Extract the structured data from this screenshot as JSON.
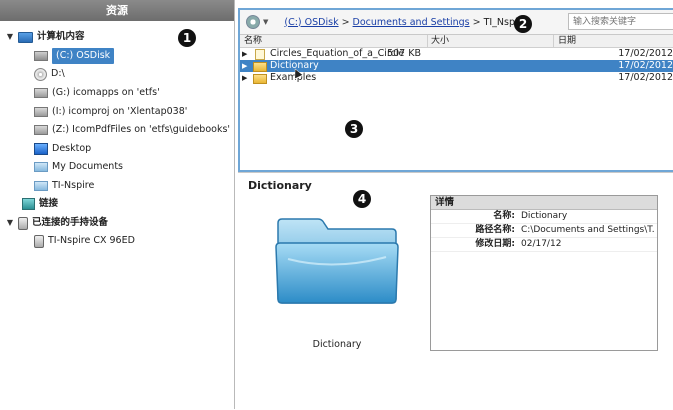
{
  "left_panel": {
    "header": "资源",
    "tree": [
      {
        "label": "计算机内容",
        "icon": "computer-icon",
        "expander": "▼",
        "bold": true
      },
      {
        "label": "(C:) OSDisk",
        "icon": "disk-drive-icon",
        "selected": true
      },
      {
        "label": "D:\\",
        "icon": "dvd-drive-icon"
      },
      {
        "label": "(G:) icomapps on 'etfs'",
        "icon": "network-drive-icon"
      },
      {
        "label": "(I:) icomproj on 'Xlentap038'",
        "icon": "network-drive-icon"
      },
      {
        "label": "(Z:) IcomPdfFiles on 'etfs\\guidebooks'",
        "icon": "network-drive-icon"
      },
      {
        "label": "Desktop",
        "icon": "desktop-icon"
      },
      {
        "label": "My Documents",
        "icon": "folder-icon"
      },
      {
        "label": "TI-Nspire",
        "icon": "folder-icon"
      },
      {
        "label": "链接",
        "icon": "link-icon",
        "bold": true
      },
      {
        "label": "已连接的手持设备",
        "icon": "handheld-icon",
        "expander": "▼",
        "bold": true
      },
      {
        "label": "TI-Nspire CX 96ED",
        "icon": "handheld-icon"
      }
    ]
  },
  "callouts": [
    "1",
    "2",
    "3",
    "4"
  ],
  "toolbar": {
    "breadcrumb": [
      "(C:) OSDisk",
      "Documents and Settings",
      "TI_Nspire"
    ],
    "separator": ">",
    "search_placeholder": "输入搜索关键字"
  },
  "file_list": {
    "columns": [
      "名称",
      "大小",
      "日期"
    ],
    "rows": [
      {
        "name": "Circles_Equation_of_a_Circle",
        "size": "507 KB",
        "date": "17/02/2012",
        "type": "document"
      },
      {
        "name": "Dictionary",
        "size": "",
        "date": "17/02/2012",
        "type": "folder",
        "selected": true
      },
      {
        "name": "Examples",
        "size": "",
        "date": "17/02/2012",
        "type": "folder"
      }
    ]
  },
  "preview": {
    "title": "Dictionary",
    "caption": "Dictionary",
    "details_header": "详情",
    "details": [
      {
        "key": "名称:",
        "value": "Dictionary"
      },
      {
        "key": "路径名称:",
        "value": "C:\\Documents and Settings\\T..."
      },
      {
        "key": "修改日期:",
        "value": "02/17/12"
      }
    ]
  },
  "colors": {
    "selection": "#3f83c5",
    "panel_border": "#6fa6d6",
    "header": "#7a7a7a"
  }
}
